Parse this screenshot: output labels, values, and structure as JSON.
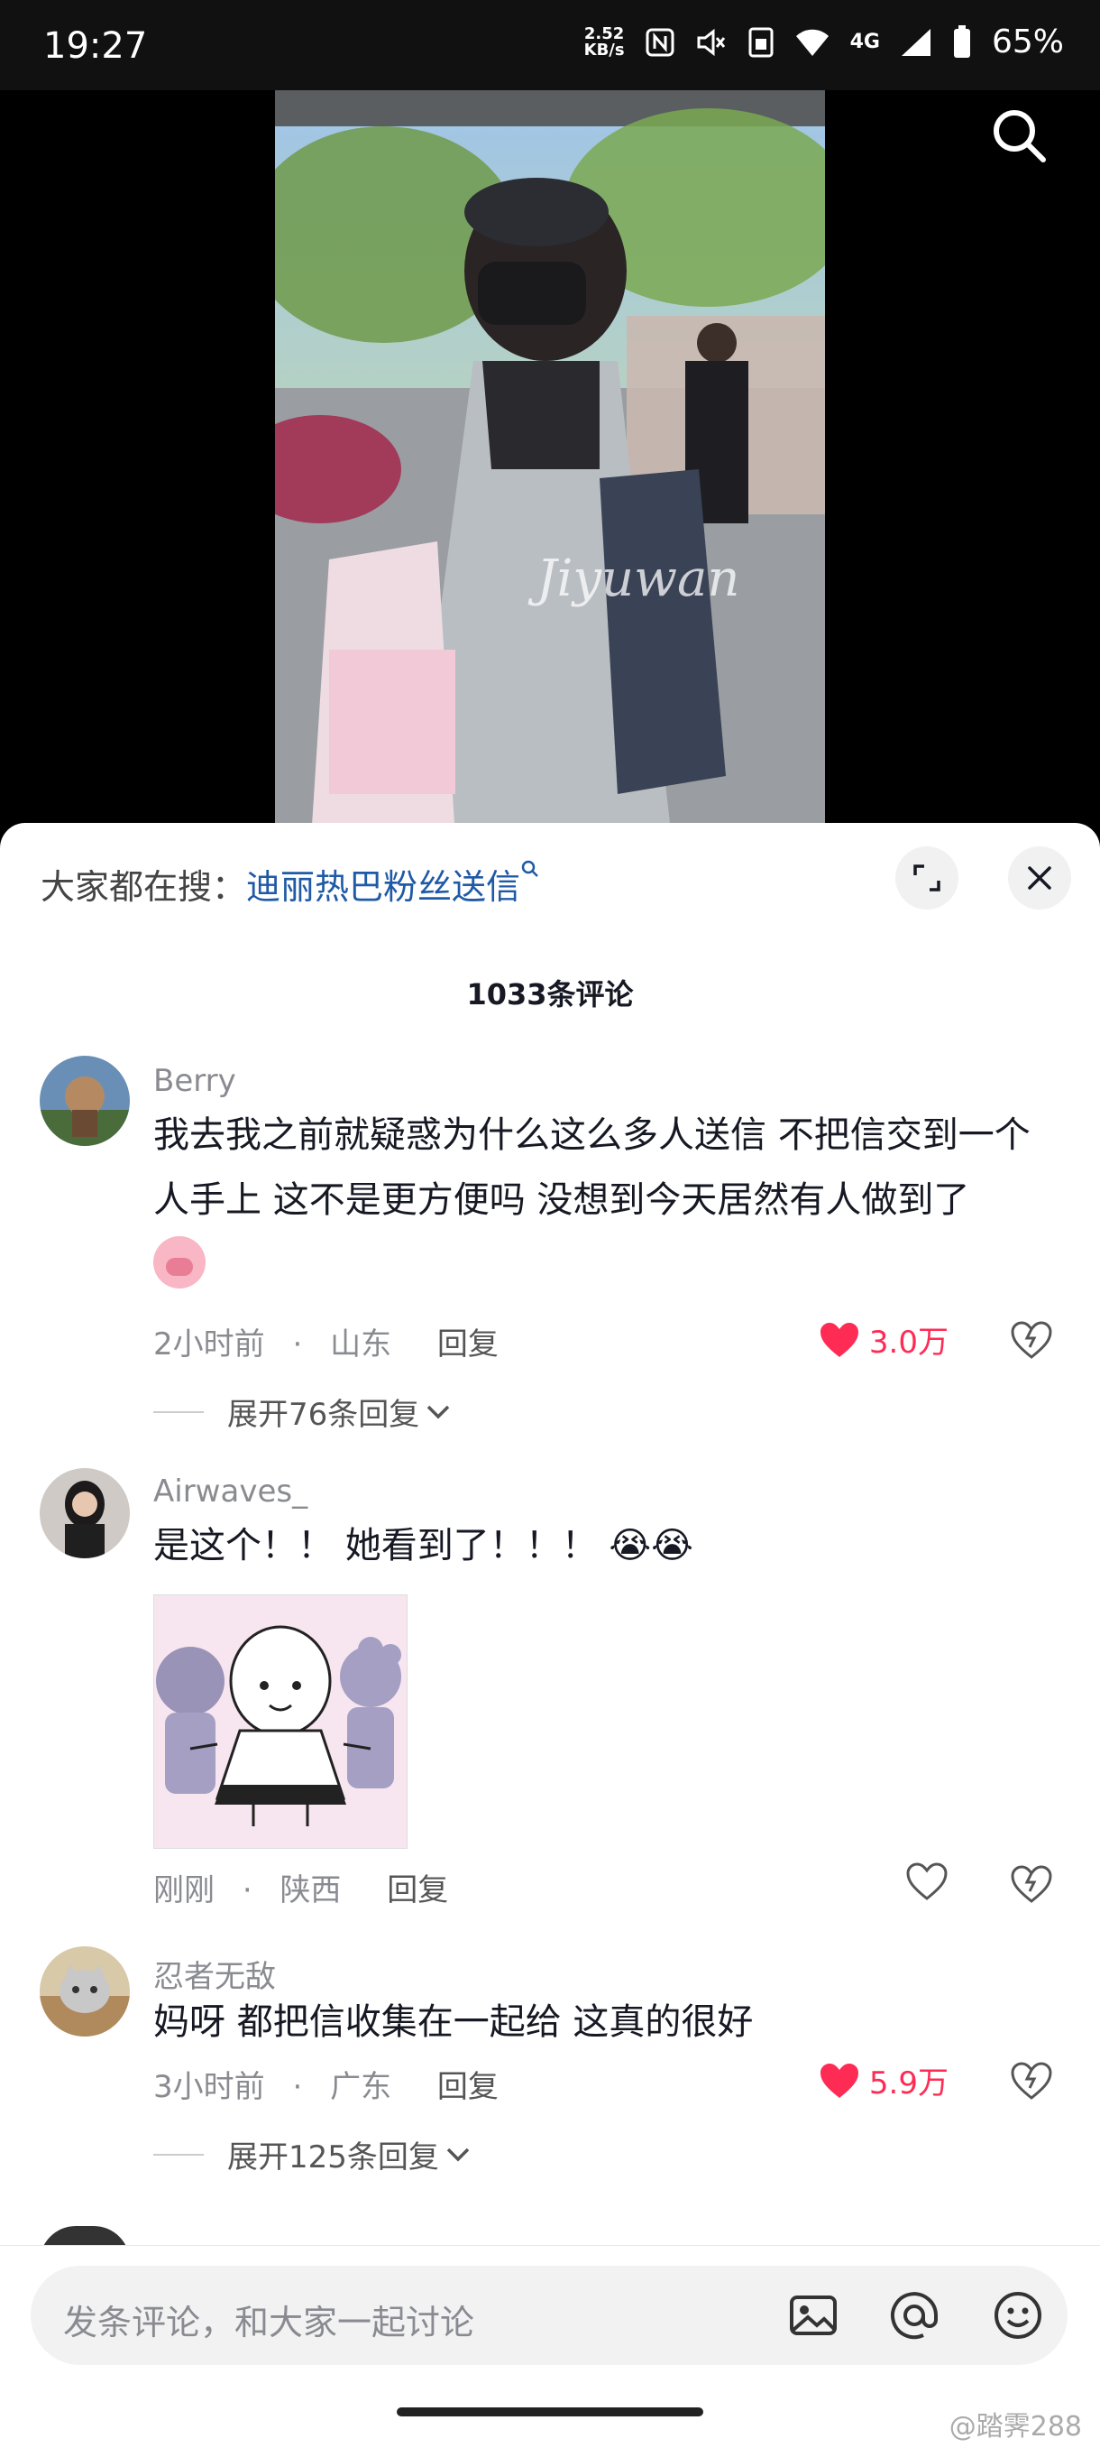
{
  "status_bar": {
    "time": "19:27",
    "net_speed_value": "2.52",
    "net_speed_unit": "KB/s",
    "network": "4G",
    "battery": "65%"
  },
  "video": {
    "watermark": "Jiyuwan"
  },
  "hot_search": {
    "prefix": "大家都在搜：",
    "query": "迪丽热巴粉丝送信"
  },
  "comments_header": {
    "count_label": "1033条评论"
  },
  "comments": [
    {
      "username": "Berry",
      "text": "我去我之前就疑惑为什么这么多人送信 不把信交到一个人手上 这不是更方便吗 没想到今天居然有人做到了",
      "emoji": "🐷",
      "time": "2小时前",
      "location": "山东",
      "reply_label": "回复",
      "likes": "3.0万",
      "liked": true,
      "expand_label": "展开76条回复"
    },
    {
      "username": "Airwaves_",
      "text": "是这个！！ 她看到了！！！ 😭😭",
      "time": "刚刚",
      "location": "陕西",
      "reply_label": "回复",
      "likes": "",
      "liked": false
    },
    {
      "username": "忍者无敌",
      "text": "妈呀 都把信收集在一起给 这真的很好",
      "time": "3小时前",
      "location": "广东",
      "reply_label": "回复",
      "likes": "5.9万",
      "liked": true,
      "expand_label": "展开125条回复"
    }
  ],
  "input": {
    "placeholder": "发条评论，和大家一起讨论"
  },
  "watermark": "@踏霁288",
  "colors": {
    "like_red": "#fe2c55",
    "link_blue": "#1f5aa6"
  }
}
